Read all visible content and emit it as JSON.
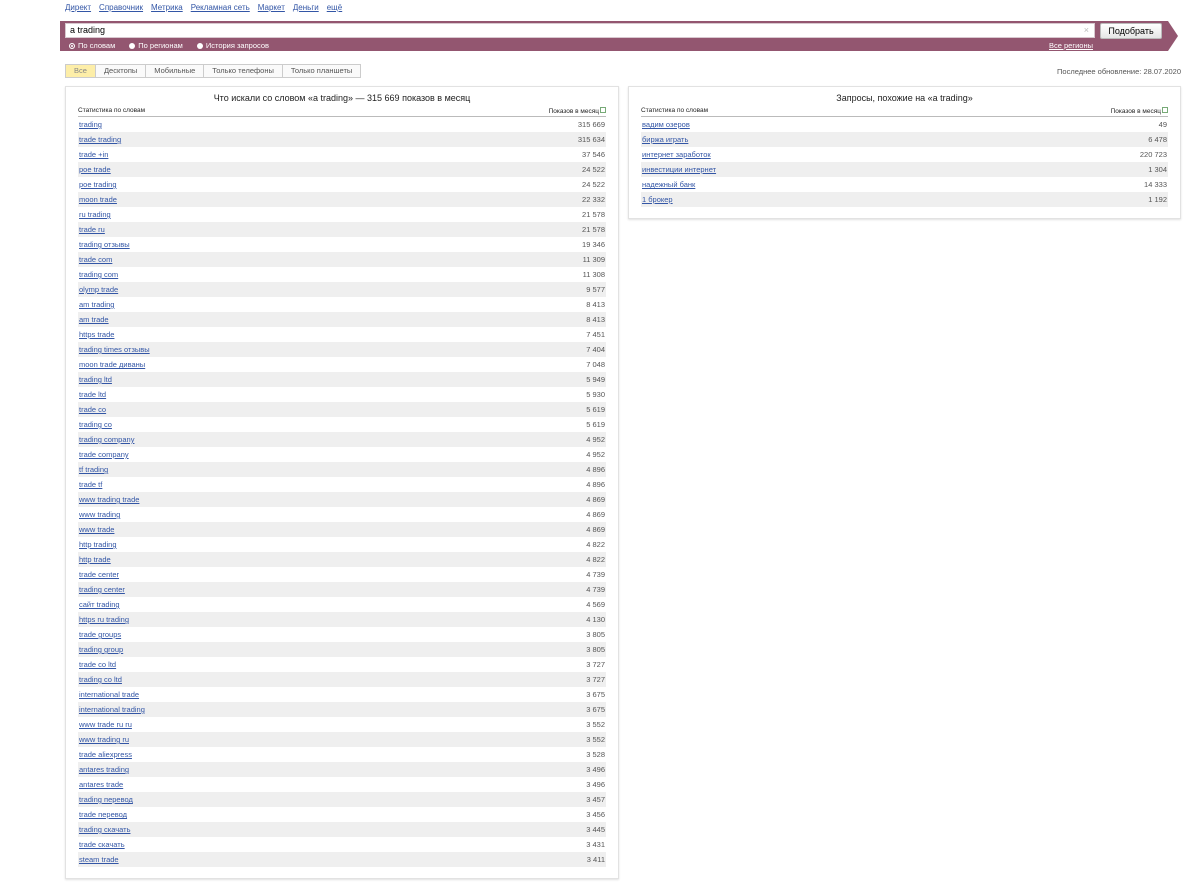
{
  "top_links": [
    "Директ",
    "Справочник",
    "Метрика",
    "Рекламная сеть",
    "Маркет",
    "Деньги",
    "ещё"
  ],
  "search": {
    "value": "a trading",
    "clear_icon": "×",
    "button": "Подобрать"
  },
  "modes": [
    {
      "label": "По словам",
      "selected": true
    },
    {
      "label": "По регионам",
      "selected": false
    },
    {
      "label": "История запросов",
      "selected": false
    }
  ],
  "regions_link": "Все регионы",
  "device_tabs": [
    {
      "label": "Все",
      "active": true
    },
    {
      "label": "Десктопы"
    },
    {
      "label": "Мобильные"
    },
    {
      "label": "Только телефоны"
    },
    {
      "label": "Только планшеты"
    }
  ],
  "last_update": "Последнее обновление: 28.07.2020",
  "left": {
    "title": "Что искали со словом «a trading» — 315 669 показов в месяц",
    "col1": "Статистика по словам",
    "col2": "Показов в месяц",
    "rows": [
      [
        "trading",
        "315 669"
      ],
      [
        "trade trading",
        "315 634"
      ],
      [
        "trade +in",
        "37 546"
      ],
      [
        "poe trade",
        "24 522"
      ],
      [
        "poe trading",
        "24 522"
      ],
      [
        "moon trade",
        "22 332"
      ],
      [
        "ru trading",
        "21 578"
      ],
      [
        "trade ru",
        "21 578"
      ],
      [
        "trading отзывы",
        "19 346"
      ],
      [
        "trade com",
        "11 309"
      ],
      [
        "trading com",
        "11 308"
      ],
      [
        "olymp trade",
        "9 577"
      ],
      [
        "am trading",
        "8 413"
      ],
      [
        "am trade",
        "8 413"
      ],
      [
        "https trade",
        "7 451"
      ],
      [
        "trading times отзывы",
        "7 404"
      ],
      [
        "moon trade диваны",
        "7 048"
      ],
      [
        "trading ltd",
        "5 949"
      ],
      [
        "trade ltd",
        "5 930"
      ],
      [
        "trade co",
        "5 619"
      ],
      [
        "trading co",
        "5 619"
      ],
      [
        "trading company",
        "4 952"
      ],
      [
        "trade company",
        "4 952"
      ],
      [
        "tf trading",
        "4 896"
      ],
      [
        "trade tf",
        "4 896"
      ],
      [
        "www trading trade",
        "4 869"
      ],
      [
        "www trading",
        "4 869"
      ],
      [
        "www trade",
        "4 869"
      ],
      [
        "http trading",
        "4 822"
      ],
      [
        "http trade",
        "4 822"
      ],
      [
        "trade center",
        "4 739"
      ],
      [
        "trading center",
        "4 739"
      ],
      [
        "сайт trading",
        "4 569"
      ],
      [
        "https ru trading",
        "4 130"
      ],
      [
        "trade groups",
        "3 805"
      ],
      [
        "trading group",
        "3 805"
      ],
      [
        "trade co ltd",
        "3 727"
      ],
      [
        "trading co ltd",
        "3 727"
      ],
      [
        "international trade",
        "3 675"
      ],
      [
        "international trading",
        "3 675"
      ],
      [
        "www trade ru ru",
        "3 552"
      ],
      [
        "www trading ru",
        "3 552"
      ],
      [
        "trade aliexpress",
        "3 528"
      ],
      [
        "antares trading",
        "3 496"
      ],
      [
        "antares trade",
        "3 496"
      ],
      [
        "trading перевод",
        "3 457"
      ],
      [
        "trade перевод",
        "3 456"
      ],
      [
        "trading скачать",
        "3 445"
      ],
      [
        "trade скачать",
        "3 431"
      ],
      [
        "steam trade",
        "3 411"
      ]
    ]
  },
  "right": {
    "title": "Запросы, похожие на «a trading»",
    "col1": "Статистика по словам",
    "col2": "Показов в месяц",
    "rows": [
      [
        "вадим озеров",
        "49"
      ],
      [
        "биржа играть",
        "6 478"
      ],
      [
        "интернет заработок",
        "220 723"
      ],
      [
        "инвестиции интернет",
        "1 304"
      ],
      [
        "надежный банк",
        "14 333"
      ],
      [
        "1 брокер",
        "1 192"
      ]
    ]
  }
}
